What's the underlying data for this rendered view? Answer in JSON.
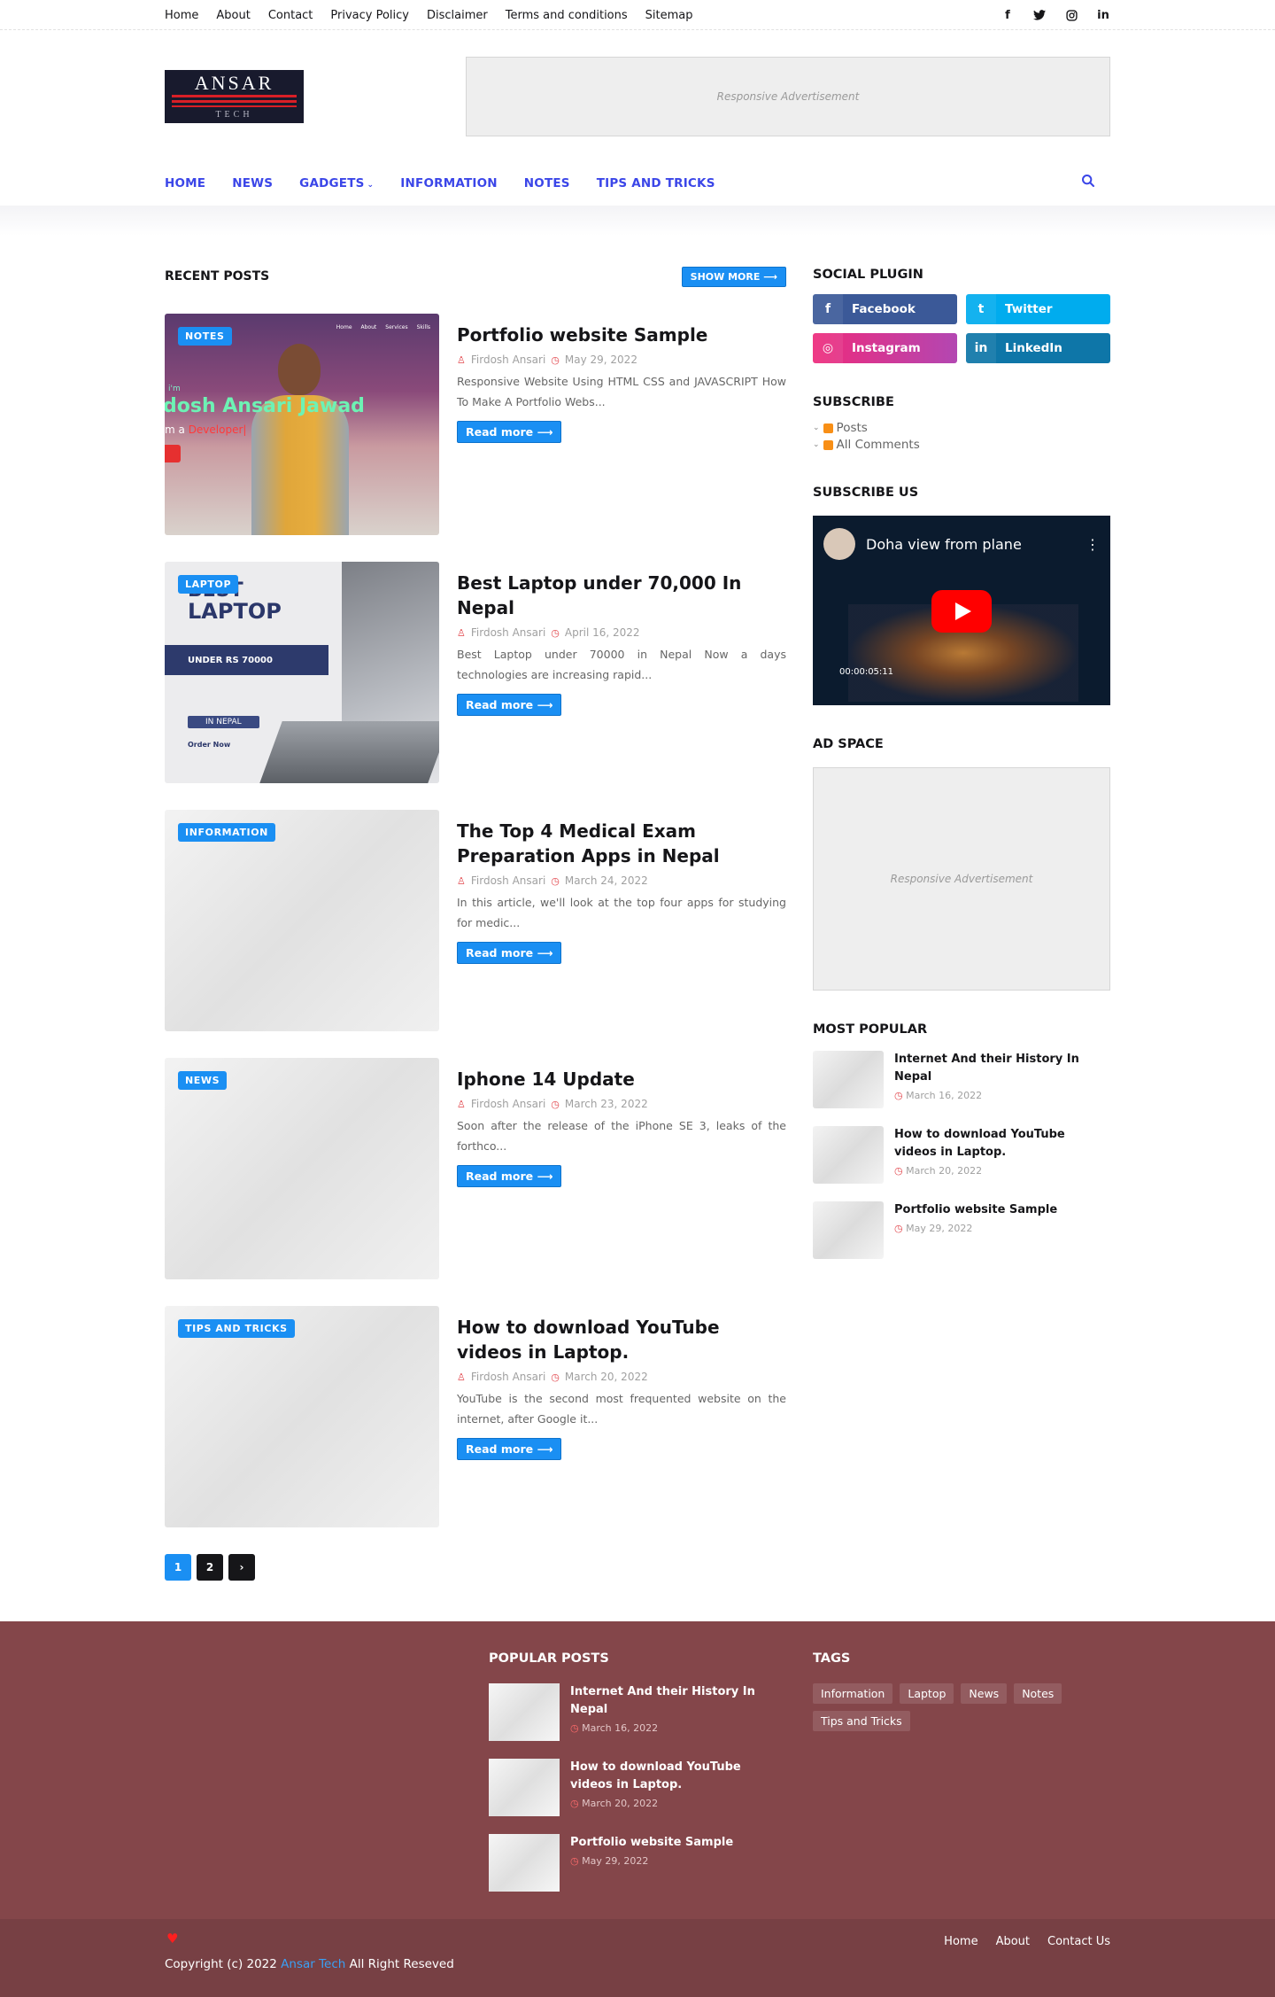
{
  "topbar": {
    "menu": [
      "Home",
      "About",
      "Contact",
      "Privacy Policy",
      "Disclaimer",
      "Terms and conditions",
      "Sitemap"
    ],
    "social_icons": [
      "facebook-icon",
      "twitter-icon",
      "instagram-icon",
      "linkedin-icon"
    ]
  },
  "header": {
    "logo_text": "ANSAR",
    "logo_sub": "TECH",
    "ad_text": "Responsive Advertisement"
  },
  "nav": {
    "items": [
      "HOME",
      "NEWS",
      "GADGETS",
      "INFORMATION",
      "NOTES",
      "TIPS AND TRICKS"
    ],
    "accent": "#3b46e8"
  },
  "recent": {
    "title": "RECENT POSTS",
    "show_more": "SHOW MORE",
    "read_more": "Read more",
    "posts": [
      {
        "label": "NOTES",
        "title": "Portfolio website Sample",
        "author": "Firdosh Ansari",
        "date": "May 29, 2022",
        "snippet": "Responsive Website Using HTML CSS and JAVASCRIPT How To Make A Portfolio Webs..."
      },
      {
        "label": "LAPTOP",
        "title": "Best Laptop under 70,000 In Nepal",
        "author": "Firdosh Ansari",
        "date": "April 16, 2022",
        "snippet": "Best Laptop under 70000 in Nepal Now a days technologies are increasing rapid..."
      },
      {
        "label": "INFORMATION",
        "title": "The Top 4 Medical Exam Preparation Apps in Nepal",
        "author": "Firdosh Ansari",
        "date": "March 24, 2022",
        "snippet": "In this article, we'll look at the top four apps for studying for medic..."
      },
      {
        "label": "NEWS",
        "title": "Iphone 14 Update",
        "author": "Firdosh Ansari",
        "date": "March 23, 2022",
        "snippet": "Soon after the release of the iPhone SE 3, leaks of the forthco..."
      },
      {
        "label": "TIPS AND TRICKS",
        "title": "How to download YouTube videos in Laptop.",
        "author": "Firdosh Ansari",
        "date": "March 20, 2022",
        "snippet": "YouTube is the second most frequented website on the internet, after Google it..."
      }
    ],
    "thumb1": {
      "menu": [
        "Home",
        "About",
        "Services",
        "Skills"
      ],
      "name": "dosh Ansari Jawad",
      "role_pre": "m a",
      "role": "Developer|",
      "hello": "i'm"
    },
    "thumb2": {
      "line1": "BEST",
      "line2": "LAPTOP",
      "price": "UNDER RS 70000",
      "place": "IN NEPAL",
      "order": "Order Now"
    }
  },
  "pager": {
    "pages": [
      "1",
      "2"
    ],
    "next": "›"
  },
  "sidebar": {
    "social_title": "SOCIAL PLUGIN",
    "social": [
      {
        "name": "Facebook",
        "icon": "f"
      },
      {
        "name": "Twitter",
        "icon": "t"
      },
      {
        "name": "Instagram",
        "icon": "◎"
      },
      {
        "name": "LinkedIn",
        "icon": "in"
      }
    ],
    "subscribe_title": "SUBSCRIBE",
    "subscribe_items": [
      "Posts",
      "All Comments"
    ],
    "subscribe_us_title": "SUBSCRIBE US",
    "video_title": "Doha view from plane",
    "video_time": "00:00:05:11",
    "ad_title": "AD SPACE",
    "ad_text": "Responsive Advertisement",
    "popular_title": "MOST POPULAR",
    "popular": [
      {
        "title": "Internet And their History In Nepal",
        "date": "March 16, 2022"
      },
      {
        "title": "How to download YouTube videos in Laptop.",
        "date": "March 20, 2022"
      },
      {
        "title": "Portfolio website Sample",
        "date": "May 29, 2022"
      }
    ]
  },
  "footer": {
    "popular_title": "POPULAR POSTS",
    "popular": [
      {
        "title": "Internet And their History In Nepal",
        "date": "March 16, 2022"
      },
      {
        "title": "How to download YouTube videos in Laptop.",
        "date": "March 20, 2022"
      },
      {
        "title": "Portfolio website Sample",
        "date": "May 29, 2022"
      }
    ],
    "tags_title": "TAGS",
    "tags": [
      "Information",
      "Laptop",
      "News",
      "Notes",
      "Tips and Tricks"
    ],
    "copy_pre": "Copyright (c) 2022",
    "copy_brand": "Ansar Tech",
    "copy_post": "All Right Reseved",
    "menu": [
      "Home",
      "About",
      "Contact Us"
    ],
    "bg": "#84464a"
  }
}
